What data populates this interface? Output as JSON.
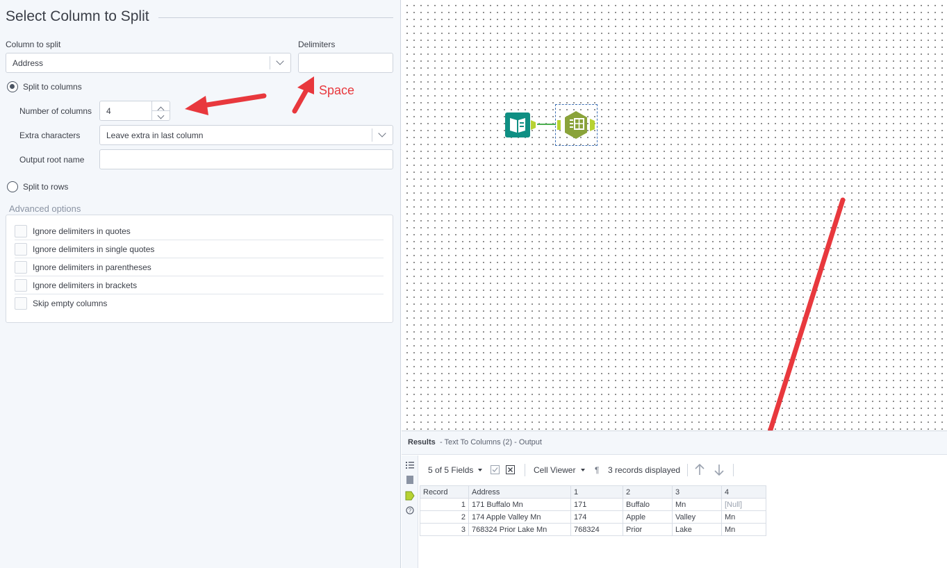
{
  "config": {
    "title": "Select Column to Split",
    "column_to_split_label": "Column to split",
    "column_to_split_value": "Address",
    "delimiters_label": "Delimiters",
    "delimiters_value": "",
    "split_to_columns_label": "Split to columns",
    "number_of_columns_label": "Number of columns",
    "number_of_columns_value": "4",
    "extra_characters_label": "Extra characters",
    "extra_characters_value": "Leave extra in last column",
    "output_root_name_label": "Output root name",
    "output_root_name_value": "",
    "split_to_rows_label": "Split to rows",
    "selected_mode": "split_to_columns",
    "advanced_title": "Advanced options",
    "advanced_options": [
      {
        "label": "Ignore delimiters in quotes",
        "checked": false
      },
      {
        "label": "Ignore delimiters in single quotes",
        "checked": false
      },
      {
        "label": "Ignore delimiters in parentheses",
        "checked": false
      },
      {
        "label": "Ignore delimiters in brackets",
        "checked": false
      },
      {
        "label": "Skip empty columns",
        "checked": false
      }
    ],
    "annotation_text": "Space",
    "annotation_color": "#e8383d"
  },
  "canvas": {
    "tools": [
      {
        "name": "Input Data",
        "icon": "book-icon",
        "color": "#0f8f83"
      },
      {
        "name": "Text To Columns",
        "icon": "text-to-columns-icon",
        "color": "#8aa33a"
      }
    ]
  },
  "results": {
    "title": "Results",
    "subtitle": "- Text To Columns (2) - Output",
    "fields_label": "5 of 5 Fields",
    "cell_viewer_label": "Cell Viewer",
    "records_label": "3 records displayed",
    "columns": [
      "Record",
      "Address",
      "1",
      "2",
      "3",
      "4"
    ],
    "rows": [
      [
        "1",
        "171 Buffalo Mn",
        "171",
        "Buffalo",
        "Mn",
        "[Null]"
      ],
      [
        "2",
        "174 Apple Valley Mn",
        "174",
        "Apple",
        "Valley",
        "Mn"
      ],
      [
        "3",
        "768324 Prior Lake Mn",
        "768324",
        "Prior",
        "Lake",
        "Mn"
      ]
    ]
  }
}
